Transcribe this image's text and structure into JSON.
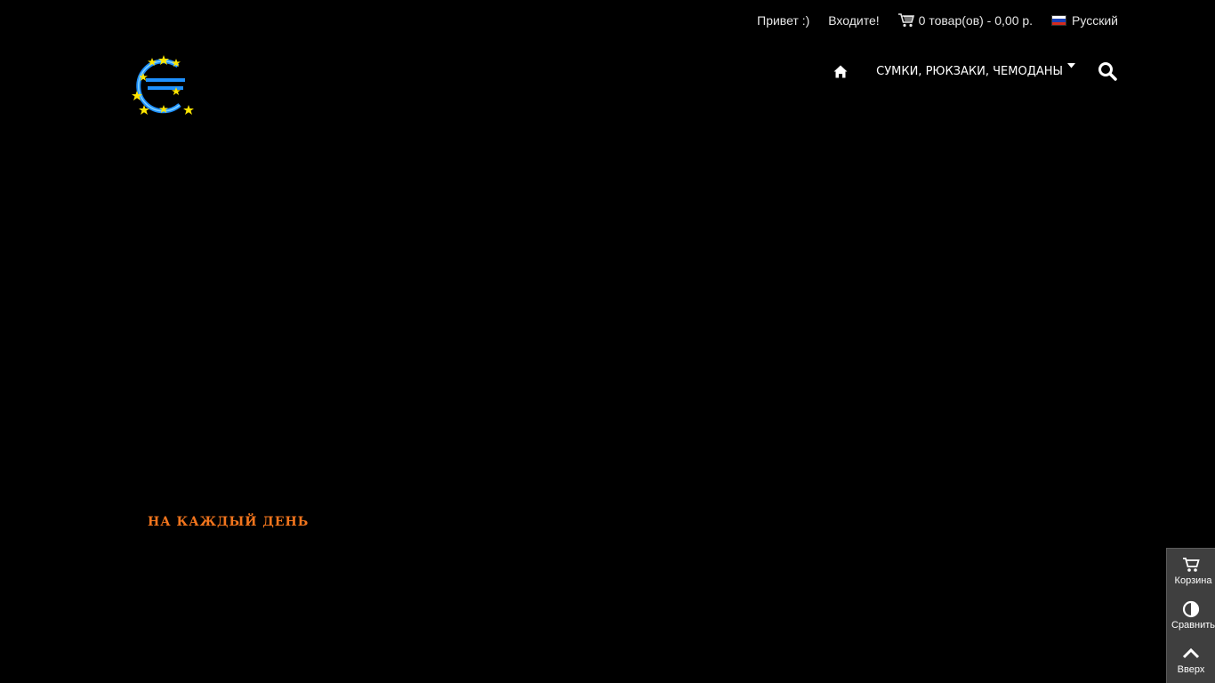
{
  "header": {
    "greeting": "Привет :)",
    "login_link": "Входите!",
    "cart_summary": "0 товар(ов) - 0,00 р.",
    "language": "Русский",
    "language_flag_colors": [
      "#ffffff",
      "#1c3fb5",
      "#d52b1e"
    ]
  },
  "logo": {
    "icon": "euro-stars-logo",
    "colors": {
      "ring": "#1e90ff",
      "stars": "#ffe600"
    }
  },
  "nav": {
    "home_icon": "home-icon",
    "menu_item": "СУМКИ, РЮКЗАКИ, ЧЕМОДАНЫ",
    "search_icon": "search-icon"
  },
  "hero": {
    "label": "НА КАЖДЫЙ ДЕНЬ",
    "label_color": "#f2751d"
  },
  "side_panel": {
    "cart_label": "Корзина",
    "compare_label": "Сравнить",
    "up_label": "Вверх"
  },
  "colors": {
    "background": "#000000",
    "panel": "#3f3f3f"
  }
}
